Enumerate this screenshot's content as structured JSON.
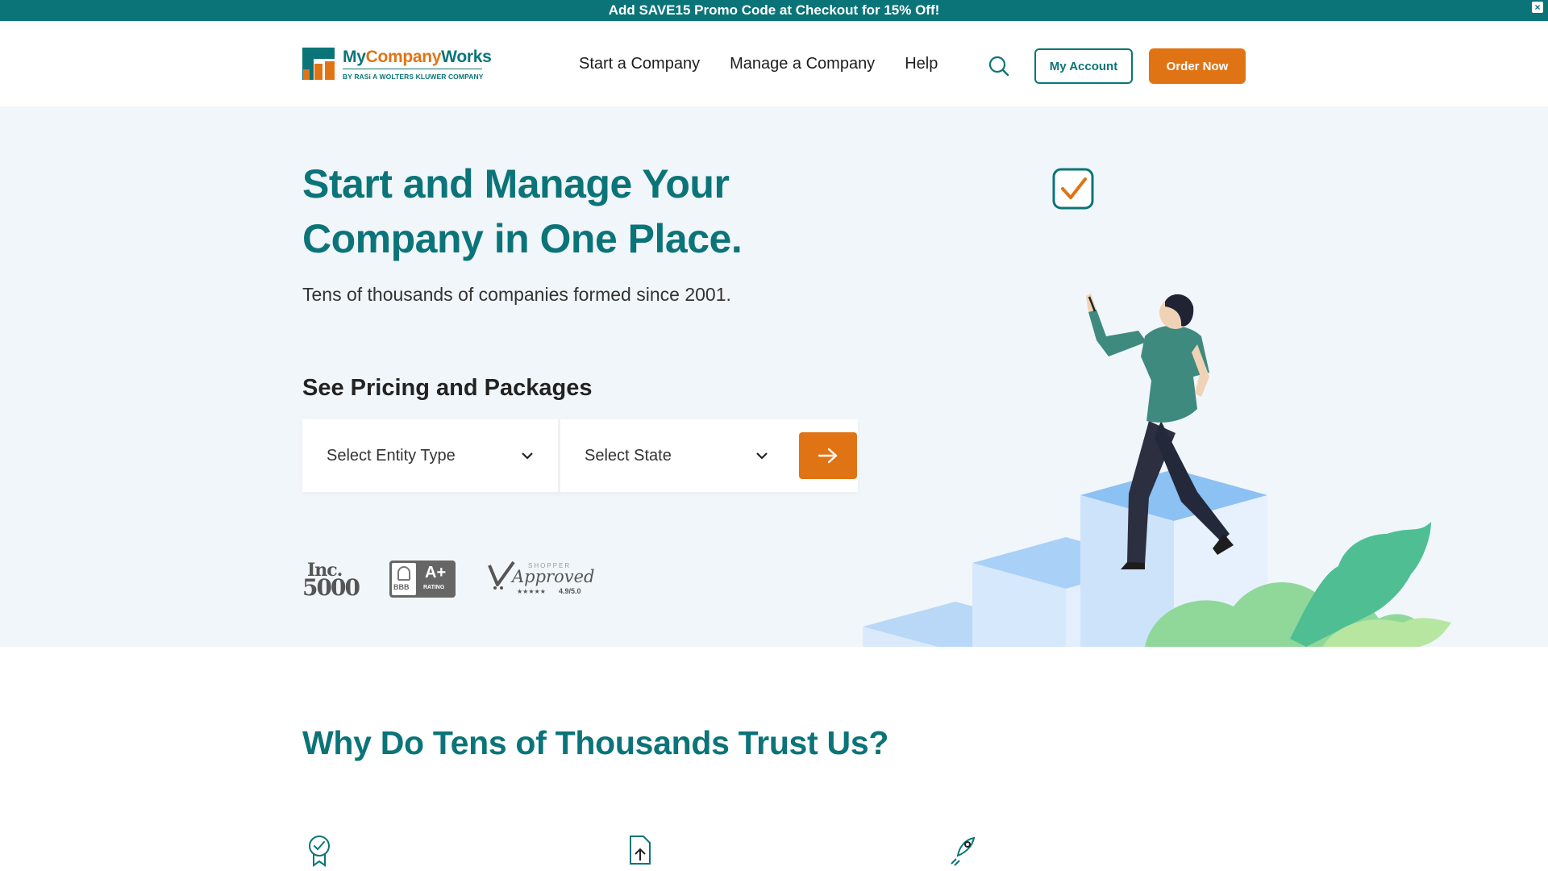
{
  "promo": {
    "text": "Add SAVE15 Promo Code at Checkout for 15% Off!",
    "close_icon": "close-icon",
    "close_glyph": "×"
  },
  "header": {
    "logo": {
      "name_part1": "My",
      "name_part2": "Company",
      "name_part3": "Works",
      "subtitle": "BY RASi A WOLTERS KLUWER COMPANY"
    },
    "nav": [
      {
        "label": "Start a Company"
      },
      {
        "label": "Manage a Company"
      },
      {
        "label": "Help"
      }
    ],
    "search_icon": "search-icon",
    "account_label": "My Account",
    "order_label": "Order Now"
  },
  "hero": {
    "title": "Start and Manage Your Company in One Place.",
    "subtitle": "Tens of thousands of companies formed since 2001.",
    "pricing_heading": "See Pricing and Packages",
    "entity_select": {
      "value": "Select Entity Type",
      "icon": "chevron-down-icon"
    },
    "state_select": {
      "value": "Select State",
      "icon": "chevron-down-icon"
    },
    "go_icon": "arrow-right-icon",
    "badges": {
      "inc": {
        "line1": "Inc.",
        "line2": "5000"
      },
      "bbb": {
        "left": "BBB",
        "grade": "A+",
        "label": "RATING"
      },
      "shopper": {
        "top": "SHOPPER",
        "word": "Approved",
        "stars": "★★★★★",
        "score": "4.9/5.0"
      }
    }
  },
  "trust": {
    "title": "Why Do Tens of Thousands Trust Us?",
    "feature_icons": [
      "award-icon",
      "file-upload-icon",
      "rocket-icon"
    ]
  },
  "colors": {
    "teal": "#0b7478",
    "orange": "#e07415",
    "hero_bg": "#f1f6fa"
  }
}
